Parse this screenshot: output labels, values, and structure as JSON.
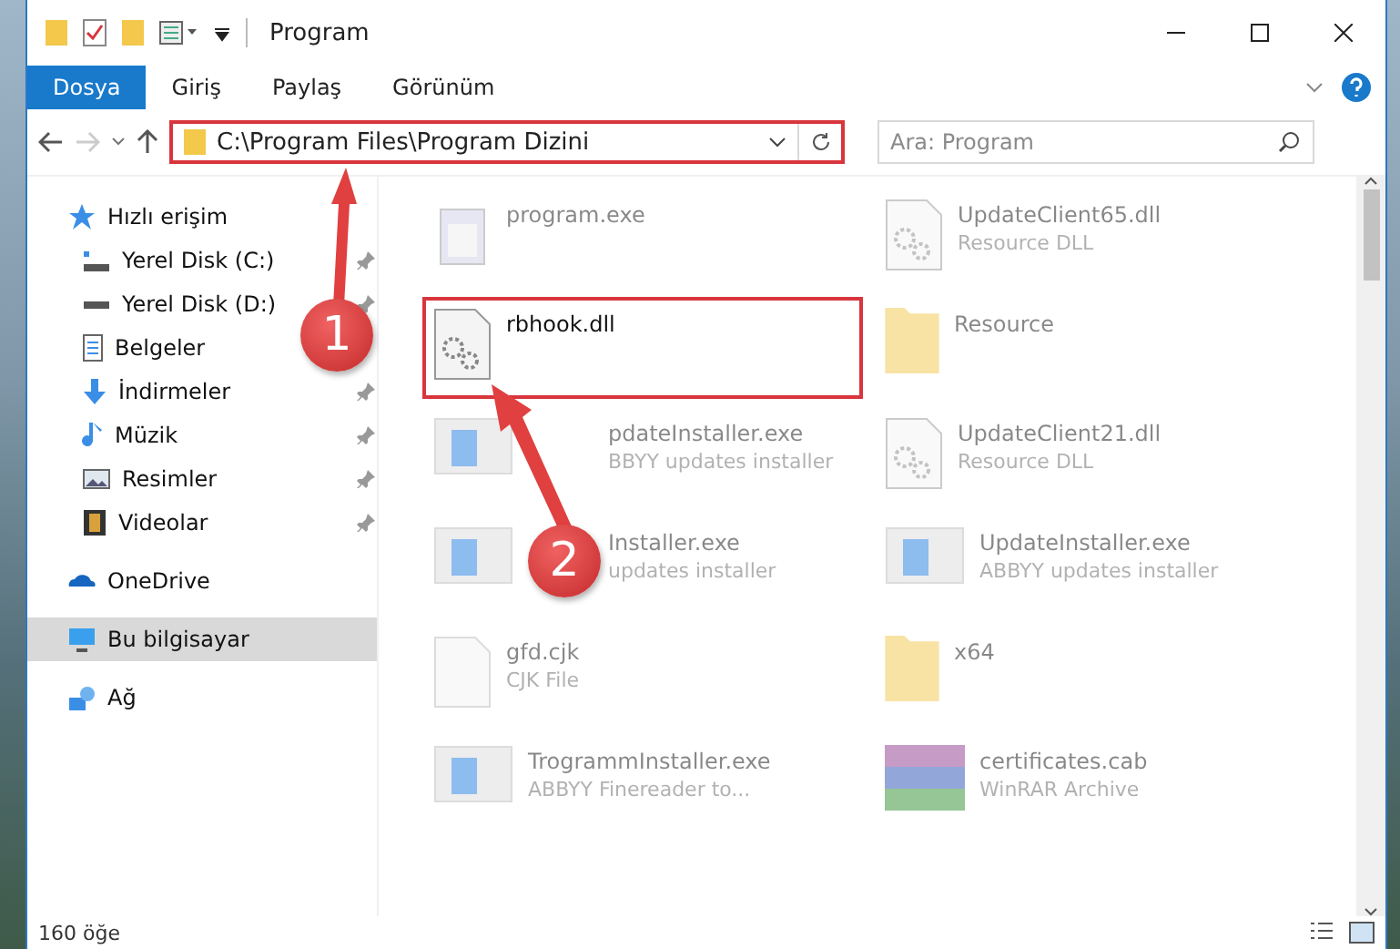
{
  "window": {
    "title": "Program"
  },
  "ribbon_tabs": [
    {
      "label": "Dosya",
      "selected": true
    },
    {
      "label": "Giriş",
      "selected": false
    },
    {
      "label": "Paylaş",
      "selected": false
    },
    {
      "label": "Görünüm",
      "selected": false
    }
  ],
  "address_bar": {
    "path": "C:\\Program Files\\Program Dizini",
    "highlighted": true
  },
  "search": {
    "placeholder": "Ara: Program"
  },
  "sidebar": {
    "items": [
      {
        "label": "Hızlı erişim",
        "kind": "star",
        "selected": false,
        "children": [
          {
            "label": "Yerel Disk (C:)",
            "kind": "drive-c",
            "pinned": true,
            "selected": false
          },
          {
            "label": "Yerel Disk (D:)",
            "kind": "drive",
            "pinned": true,
            "selected": false
          },
          {
            "label": "Belgeler",
            "kind": "documents",
            "pinned": false,
            "selected": false
          },
          {
            "label": "İndirmeler",
            "kind": "downloads",
            "pinned": true,
            "selected": false
          },
          {
            "label": "Müzik",
            "kind": "music",
            "pinned": true,
            "selected": false
          },
          {
            "label": "Resimler",
            "kind": "pictures",
            "pinned": true,
            "selected": false
          },
          {
            "label": "Videolar",
            "kind": "videos",
            "pinned": true,
            "selected": false
          }
        ]
      },
      {
        "label": "OneDrive",
        "kind": "cloud",
        "selected": false
      },
      {
        "label": "Bu bilgisayar",
        "kind": "computer",
        "selected": true
      },
      {
        "label": "Ağ",
        "kind": "network",
        "selected": false
      }
    ]
  },
  "files": [
    {
      "name": "program.exe",
      "kind": "exe",
      "blurred": true,
      "highlighted": false,
      "covered": false
    },
    {
      "name": "UpdateClient65.dll",
      "type": "Resource DLL",
      "kind": "dll",
      "blurred": true,
      "highlighted": false,
      "covered": false
    },
    {
      "name": "rbhook.dll",
      "kind": "dll",
      "blurred": false,
      "highlighted": true,
      "covered": false
    },
    {
      "name": "Resource",
      "kind": "folder",
      "blurred": true,
      "highlighted": false,
      "covered": false
    },
    {
      "name": "pdateInstaller.exe",
      "type": "BBYY updates installer",
      "kind": "installer",
      "blurred": true,
      "highlighted": false,
      "covered": true
    },
    {
      "name": "UpdateClient21.dll",
      "type": "Resource DLL",
      "kind": "dll",
      "blurred": true,
      "highlighted": false,
      "covered": false
    },
    {
      "name": "Installer.exe",
      "type": "updates installer",
      "kind": "installer",
      "blurred": true,
      "highlighted": false,
      "covered": true
    },
    {
      "name": "UpdateInstaller.exe",
      "type": "ABBYY updates installer",
      "kind": "installer",
      "blurred": true,
      "highlighted": false,
      "covered": false
    },
    {
      "name": "gfd.cjk",
      "type": "CJK File",
      "kind": "file",
      "blurred": true,
      "highlighted": false,
      "covered": false
    },
    {
      "name": "x64",
      "kind": "folder",
      "blurred": true,
      "highlighted": false,
      "covered": false
    },
    {
      "name": "TrogrammInstaller.exe",
      "type": "ABBYY Finereader to...",
      "kind": "installer",
      "blurred": true,
      "highlighted": false,
      "covered": false
    },
    {
      "name": "certificates.cab",
      "type": "WinRAR Archive",
      "kind": "archive",
      "blurred": true,
      "highlighted": false,
      "covered": false
    }
  ],
  "annotations": [
    {
      "label": "1"
    },
    {
      "label": "2"
    }
  ],
  "status_bar": {
    "item_count": "160 öğe"
  }
}
